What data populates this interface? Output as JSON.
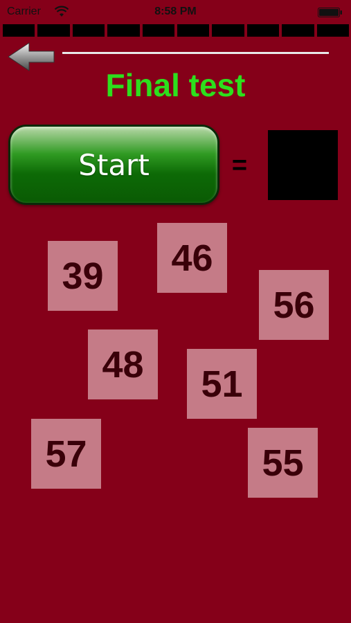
{
  "status_bar": {
    "carrier": "Carrier",
    "time": "8:58 PM",
    "wifi_icon": "wifi-icon",
    "battery_icon": "battery-icon"
  },
  "progress": {
    "total_segments": 10,
    "completed_segments": 0
  },
  "header": {
    "back_icon": "arrow-left-icon",
    "title": "Final test"
  },
  "equation": {
    "start_label": "Start",
    "equals": "=",
    "answer": ""
  },
  "tiles": [
    "39",
    "46",
    "56",
    "48",
    "51",
    "57",
    "55"
  ],
  "colors": {
    "background": "#850019",
    "title": "#2ddf1d",
    "tile": "#c57b87",
    "tile_text": "#3a0009",
    "start_button": "#1f7f14"
  }
}
